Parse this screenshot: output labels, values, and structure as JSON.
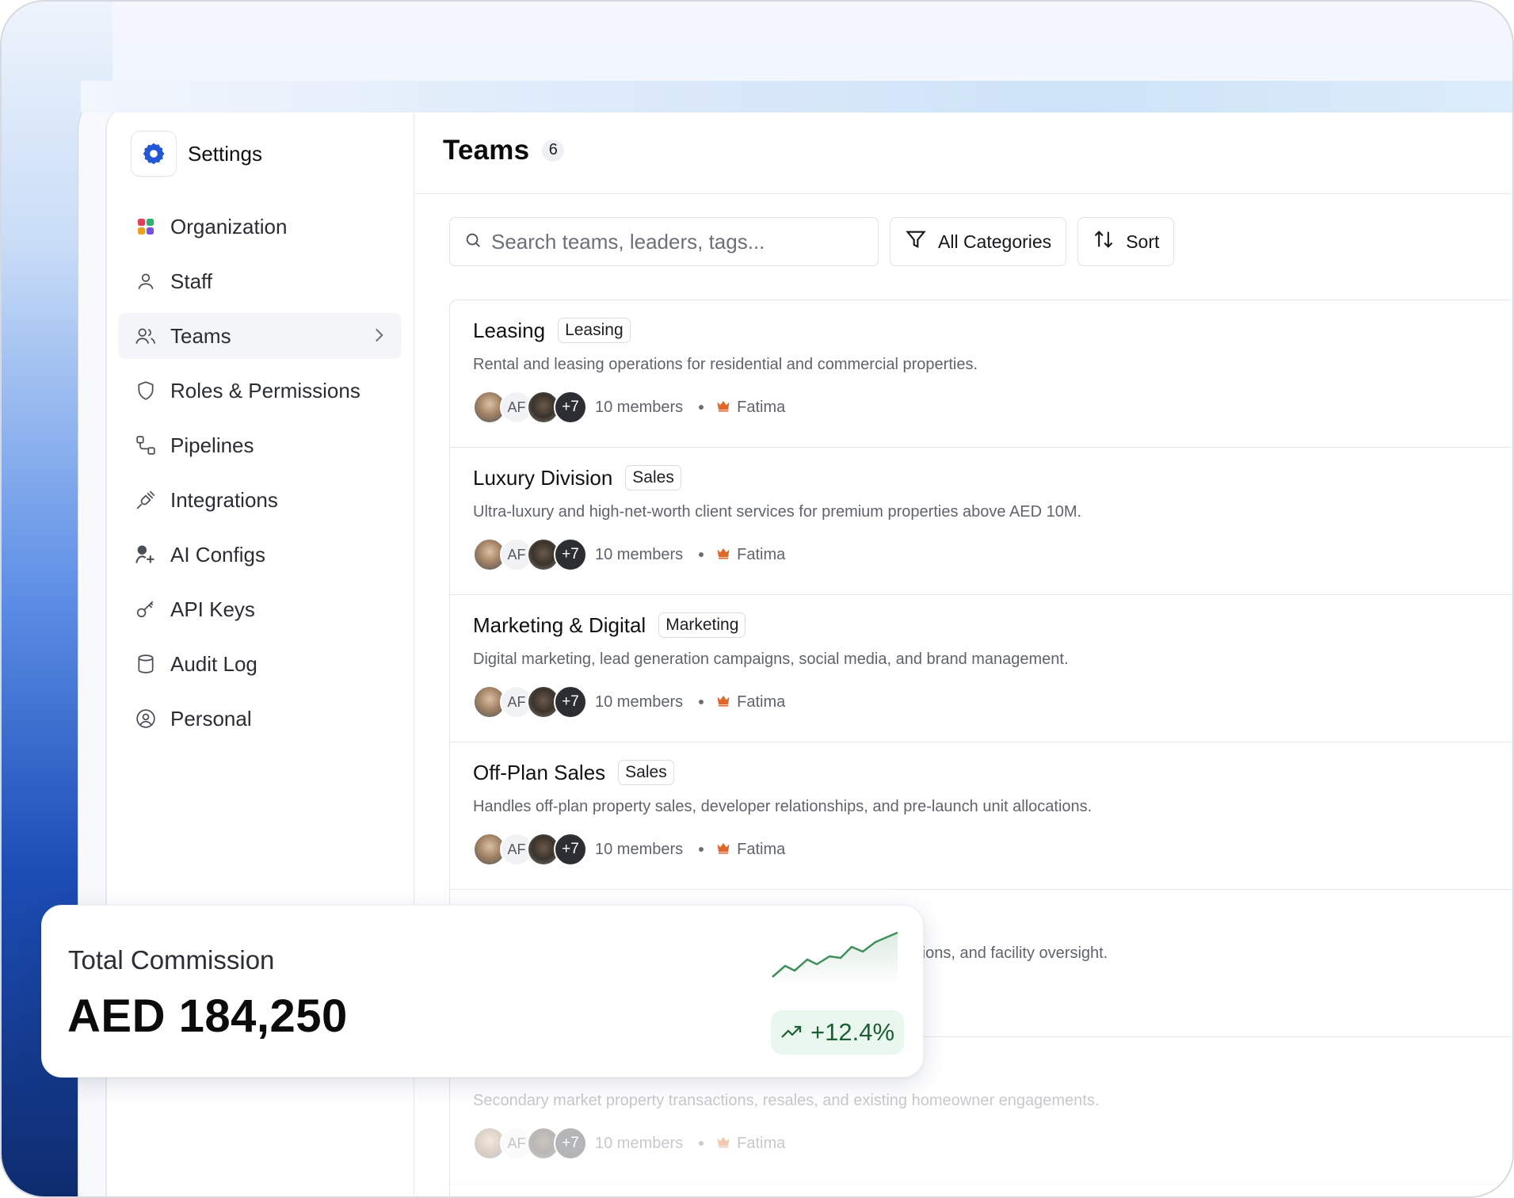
{
  "sidebar": {
    "title": "Settings",
    "items": [
      {
        "label": "Organization",
        "icon": "grid-dots-icon"
      },
      {
        "label": "Staff",
        "icon": "user-icon"
      },
      {
        "label": "Teams",
        "icon": "users-icon",
        "active": true
      },
      {
        "label": "Roles & Permissions",
        "icon": "shield-icon"
      },
      {
        "label": "Pipelines",
        "icon": "pipeline-icon"
      },
      {
        "label": "Integrations",
        "icon": "plug-icon"
      },
      {
        "label": "AI Configs",
        "icon": "ai-user-icon"
      },
      {
        "label": "API Keys",
        "icon": "key-icon"
      },
      {
        "label": "Audit Log",
        "icon": "database-icon"
      },
      {
        "label": "Personal",
        "icon": "user-circle-icon"
      }
    ]
  },
  "header": {
    "title": "Teams",
    "count": "6"
  },
  "toolbar": {
    "search_placeholder": "Search teams, leaders, tags...",
    "category_label": "All Categories",
    "sort_label": "Sort"
  },
  "teams": [
    {
      "name": "Leasing",
      "tag": "Leasing",
      "description": "Rental and leasing operations for residential and commercial properties.",
      "initials": "AF",
      "more": "+7",
      "members": "10 members",
      "leader": "Fatima"
    },
    {
      "name": "Luxury Division",
      "tag": "Sales",
      "description": "Ultra-luxury and high-net-worth client services for premium properties above AED 10M.",
      "initials": "AF",
      "more": "+7",
      "members": "10 members",
      "leader": "Fatima"
    },
    {
      "name": "Marketing & Digital",
      "tag": "Marketing",
      "description": "Digital marketing, lead generation campaigns, social media, and brand management.",
      "initials": "AF",
      "more": "+7",
      "members": "10 members",
      "leader": "Fatima"
    },
    {
      "name": "Off-Plan Sales",
      "tag": "Sales",
      "description": "Handles off-plan property sales, developer relationships, and pre-launch unit allocations.",
      "initials": "AF",
      "more": "+7",
      "members": "10 members",
      "leader": "Fatima"
    },
    {
      "name": "",
      "tag": "",
      "description": "ations, and facility oversight.",
      "initials": "",
      "more": "",
      "members": "",
      "leader": ""
    },
    {
      "name": "",
      "tag": "",
      "description": "Secondary market property transactions, resales, and existing homeowner engagements.",
      "initials": "AF",
      "more": "+7",
      "members": "10 members",
      "leader": "Fatima"
    }
  ],
  "commission_card": {
    "label": "Total Commission",
    "value": "AED 184,250",
    "trend": "+12.4%",
    "trend_color": "#1d5e35",
    "spark_color": "#3f8f5a"
  },
  "colors": {
    "accent": "#2457d6",
    "crown": "#e0662a"
  }
}
